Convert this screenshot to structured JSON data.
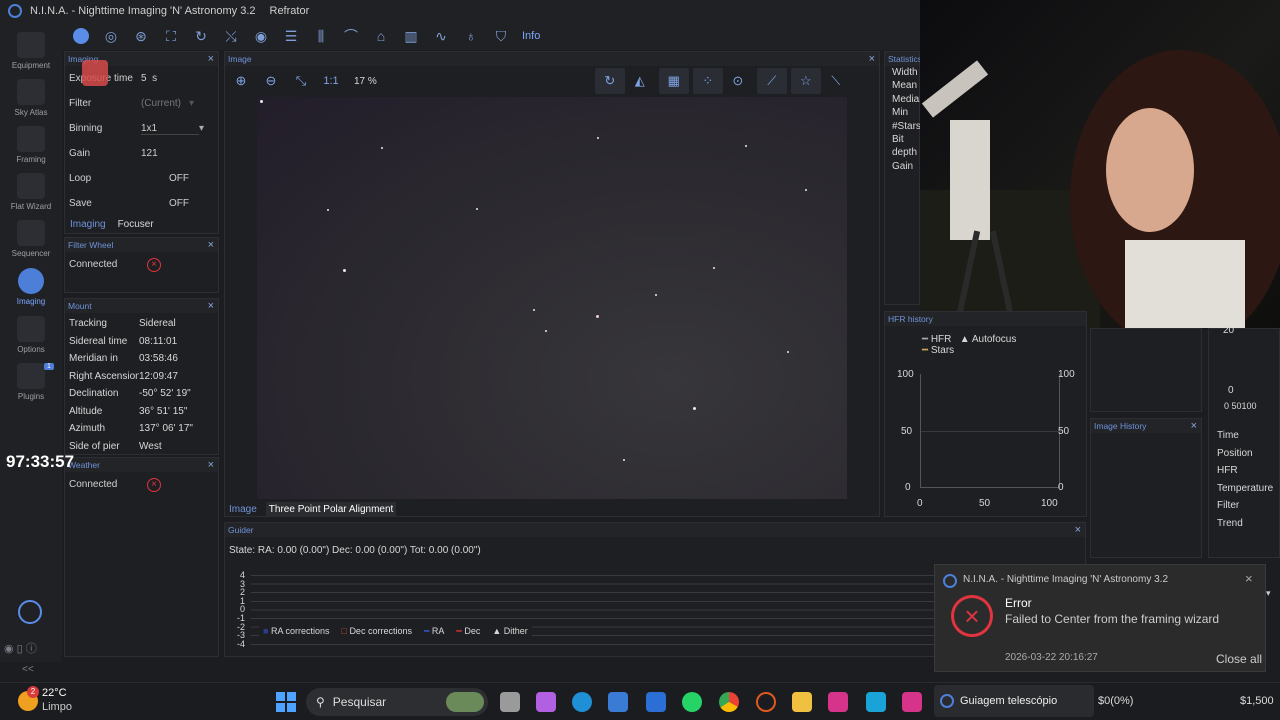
{
  "window": {
    "title": "N.I.N.A. - Nighttime Imaging 'N' Astronomy 3.2",
    "profile": "Refrator"
  },
  "nav": [
    {
      "label": "Equipment",
      "icon": "camera-icon"
    },
    {
      "label": "Sky Atlas",
      "icon": "sky-atlas-icon"
    },
    {
      "label": "Framing",
      "icon": "framing-icon"
    },
    {
      "label": "Flat Wizard",
      "icon": "flat-wizard-icon"
    },
    {
      "label": "Sequencer",
      "icon": "sequencer-icon"
    },
    {
      "label": "Imaging",
      "icon": "imaging-icon"
    },
    {
      "label": "Options",
      "icon": "gear-icon"
    },
    {
      "label": "Plugins",
      "icon": "puzzle-icon",
      "badge": "1"
    }
  ],
  "toolbar": {
    "info_label": "Info"
  },
  "imaging_panel": {
    "title": "Imaging",
    "exposure_label": "Exposure time",
    "exposure_value": "5",
    "exposure_unit": "s",
    "filter_label": "Filter",
    "filter_value": "(Current)",
    "binning_label": "Binning",
    "binning_value": "1x1",
    "gain_label": "Gain",
    "gain_value": "121",
    "loop_label": "Loop",
    "loop_value": "OFF",
    "save_label": "Save",
    "save_value": "OFF",
    "tab_imaging": "Imaging",
    "tab_focuser": "Focuser"
  },
  "filter_wheel": {
    "title": "Filter Wheel",
    "status": "Connected"
  },
  "mount": {
    "title": "Mount",
    "rows": [
      {
        "k": "Tracking",
        "v": "Sidereal"
      },
      {
        "k": "Sidereal time",
        "v": "08:11:01"
      },
      {
        "k": "Meridian in",
        "v": "03:58:46"
      },
      {
        "k": "Right Ascension",
        "v": "12:09:47"
      },
      {
        "k": "Declination",
        "v": "-50° 52' 19\""
      },
      {
        "k": "Altitude",
        "v": "36° 51' 15\""
      },
      {
        "k": "Azimuth",
        "v": "137° 06' 17\""
      },
      {
        "k": "Side of pier",
        "v": "West"
      }
    ]
  },
  "weather": {
    "title": "Weather",
    "status": "Connected"
  },
  "overlay_timer": "97:33:57",
  "image_panel": {
    "title": "Image",
    "zoom_ratio": "1:1",
    "zoom_percent": "17 %",
    "tab_image": "Image",
    "tab_tppa": "Three Point Polar Alignment"
  },
  "statistics": {
    "title": "Statistics",
    "labels": [
      "Width",
      "Mean",
      "Median",
      "Min",
      "#Stars",
      "Bit depth",
      "Gain"
    ]
  },
  "hfr_history": {
    "title": "HFR history",
    "legend_hfr": "HFR",
    "legend_autofocus": "Autofocus",
    "legend_stars": "Stars",
    "y_left": [
      "100",
      "50",
      "0"
    ],
    "y_right": [
      "100",
      "50",
      "0"
    ],
    "x": [
      "0",
      "50",
      "100"
    ]
  },
  "image_history": {
    "title": "Image History"
  },
  "right_table": {
    "y_top": "20",
    "y_zero": "0",
    "x_ticks": "0 50100",
    "rows": [
      "Time",
      "Position",
      "HFR",
      "Temperature",
      "Filter",
      "Trend"
    ]
  },
  "guider": {
    "title": "Guider",
    "state": "State:  RA: 0.00 (0.00\")  Dec: 0.00 (0.00\")  Tot: 0.00 (0.00\")",
    "y_ticks": [
      "4",
      "3",
      "2",
      "1",
      "0",
      "-1",
      "-2",
      "-3",
      "-4"
    ],
    "legend": [
      "RA corrections",
      "Dec corrections",
      "RA",
      "Dec",
      "Dither"
    ]
  },
  "toast": {
    "app": "N.I.N.A. - Nighttime Imaging 'N' Astronomy 3.2",
    "title": "Error",
    "message": "Failed to Center from the framing wizard",
    "time": "2026-03-22 20:16:27",
    "close_all": "Close all"
  },
  "taskbar": {
    "weather_temp": "22°C",
    "weather_desc": "Limpo",
    "weather_badge": "2",
    "search": "Pesquisar",
    "active_app": "Guiagem telescópio",
    "ticker1": "$0(0%)",
    "ticker2": "$1,500"
  },
  "colors": {
    "accent": "#4d7fd8",
    "error": "#e0353f",
    "panel": "#1e1f22"
  }
}
